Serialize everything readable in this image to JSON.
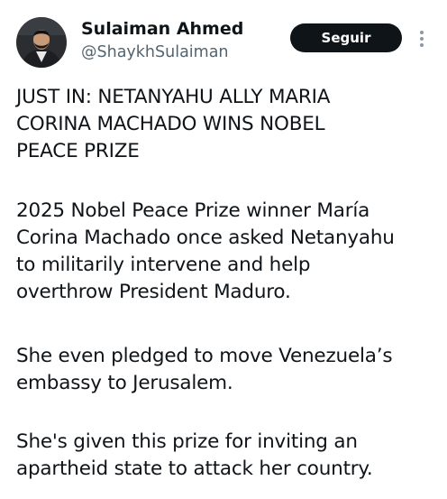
{
  "author": {
    "name": "Sulaiman Ahmed",
    "handle": "@ShaykhSulaiman",
    "avatar_icon": "user-photo-avatar"
  },
  "actions": {
    "follow_label": "Seguir",
    "more_icon": "more-vertical-icon"
  },
  "tweet": {
    "paragraphs": [
      "JUST IN: NETANYAHU ALLY MARIA\nCORINA MACHADO WINS NOBEL\nPEACE PRIZE",
      "2025 Nobel Peace Prize winner María\nCorina Machado once asked Netanyahu\nto militarily intervene and help\noverthrow President Maduro.",
      "She even pledged to move Venezuela’s\nembassy to Jerusalem.",
      "She's given this prize for inviting an\napartheid state to attack her country."
    ]
  },
  "colors": {
    "text": "#0f1419",
    "secondary_text": "#536471",
    "button_bg": "#0f1419",
    "button_text": "#ffffff",
    "background": "#ffffff"
  }
}
